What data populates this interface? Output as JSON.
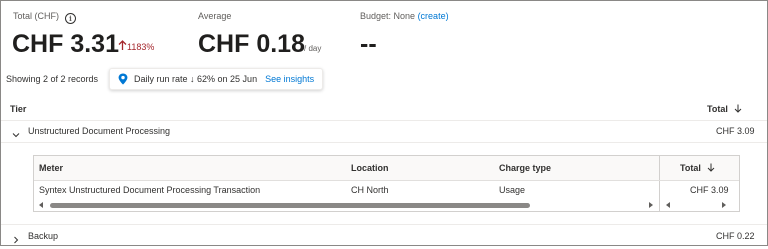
{
  "summary": {
    "total_label": "Total (CHF)",
    "total_value": "CHF 3.31",
    "total_change": "1183%",
    "average_label": "Average",
    "average_value": "CHF 0.18",
    "average_unit": "/ day",
    "budget_label": "Budget: None",
    "budget_link": "(create)",
    "budget_value": "--"
  },
  "toolbar": {
    "records_text": "Showing 2 of 2 records",
    "insight_text": "Daily run rate ↓ 62% on 25 Jun",
    "insight_link": "See insights"
  },
  "outer_table": {
    "headers": {
      "tier": "Tier",
      "total": "Total"
    },
    "rows": [
      {
        "name": "Unstructured Document Processing",
        "total": "CHF 3.09",
        "expanded": true
      },
      {
        "name": "Backup",
        "total": "CHF 0.22",
        "expanded": false
      }
    ]
  },
  "inner_table": {
    "headers": {
      "meter": "Meter",
      "location": "Location",
      "charge_type": "Charge type",
      "total": "Total"
    },
    "rows": [
      {
        "meter": "Syntex Unstructured Document Processing Transaction",
        "location": "CH North",
        "charge_type": "Usage",
        "total": "CHF 3.09"
      }
    ]
  },
  "colors": {
    "accent_link": "#0078d4",
    "increase_red": "#a4262c",
    "insight_pin_blue": "#0078d4"
  },
  "icons": {
    "info": "info-circle-icon",
    "up_arrow": "arrow-up-icon",
    "insight": "location-pin-icon",
    "sort": "arrow-down-icon",
    "expand": "chevron-icon"
  }
}
